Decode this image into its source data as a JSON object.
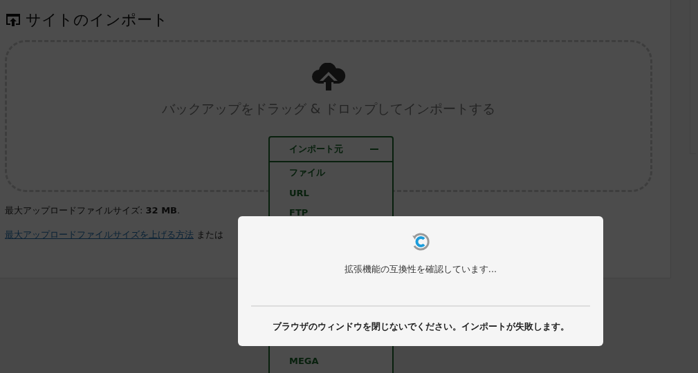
{
  "page": {
    "title": "サイトのインポート",
    "dropzone": {
      "text": "バックアップをドラッグ & ドロップしてインポートする"
    },
    "import_menu": {
      "label": "インポート元",
      "expanded": true,
      "items": [
        {
          "label": "ファイル"
        },
        {
          "label": "URL"
        },
        {
          "label": "FTP"
        },
        {
          "label": "MEGA"
        }
      ]
    },
    "max_size": "最大アップロードファイルサイズ: **32 MB**.",
    "help_link": "最大アップロードファイルサイズを上げる方法",
    "help_tail": "または"
  },
  "modal": {
    "message": "拡張機能の互換性を確認しています...",
    "warning": "ブラウザのウィンドウを閉じないでください。インポートが失敗します。"
  }
}
